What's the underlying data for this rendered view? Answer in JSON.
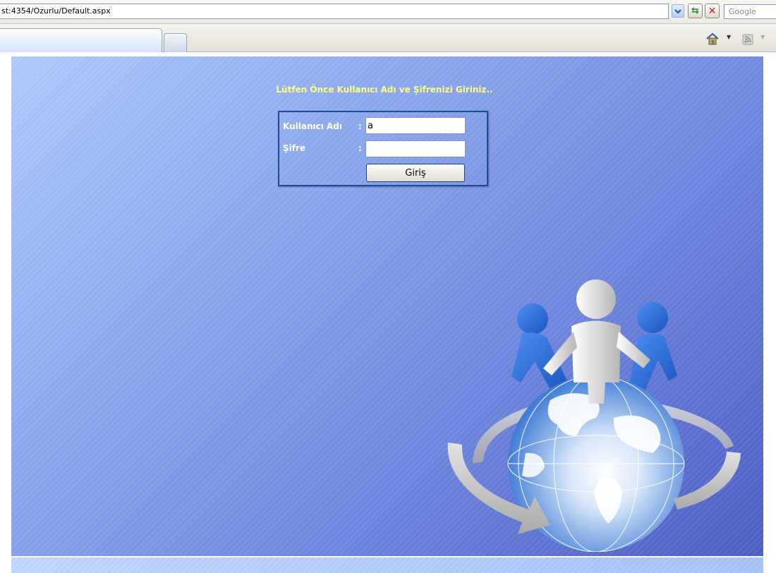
{
  "browser": {
    "address_text": "st:4354/Ozurlu/Default.aspx",
    "search_placeholder": "Google",
    "icons": {
      "address_dropdown": "chevron-down-icon",
      "refresh": "refresh-icon",
      "stop": "stop-icon",
      "home": "home-icon",
      "feed": "feed-icon"
    }
  },
  "login": {
    "heading": "Lütfen Önce Kullanıcı Adı ve Şifrenizi Giriniz..",
    "username_label": "Kullanıcı Adı",
    "password_label": "Şifre",
    "separator": ":",
    "username_value": "a",
    "password_value": "",
    "submit_label": "Giriş"
  },
  "colors": {
    "heading": "#ffff7a",
    "labels": "#ffffff",
    "box_border": "#1d4c99",
    "background_light": "#aec9f9",
    "background_dark": "#4c5cc4"
  }
}
